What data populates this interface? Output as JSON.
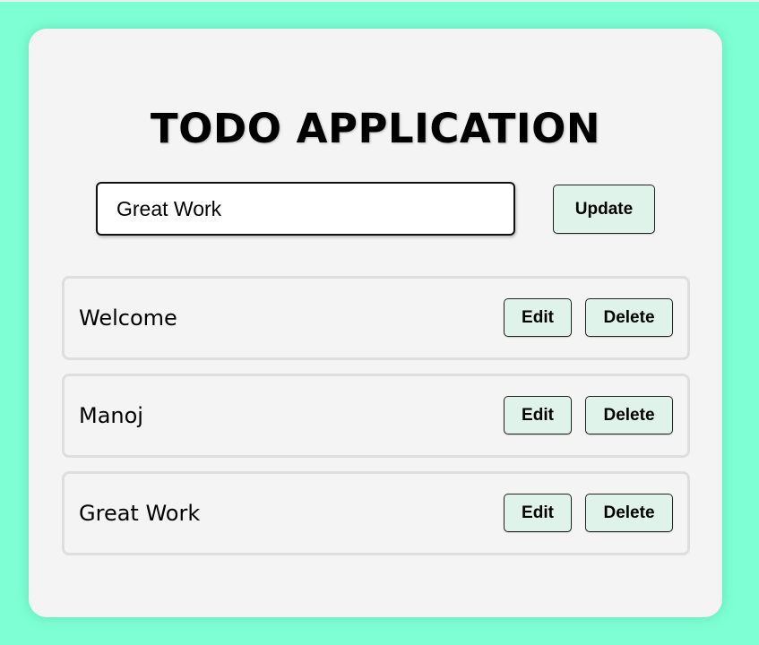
{
  "app": {
    "title": "TODO APPLICATION"
  },
  "form": {
    "input_value": "Great Work",
    "submit_label": "Update"
  },
  "todos": [
    {
      "text": "Welcome",
      "edit_label": "Edit",
      "delete_label": "Delete"
    },
    {
      "text": "Manoj",
      "edit_label": "Edit",
      "delete_label": "Delete"
    },
    {
      "text": "Great Work",
      "edit_label": "Edit",
      "delete_label": "Delete"
    }
  ],
  "colors": {
    "page_background": "#7fffd4",
    "card_background": "#f4f4f4",
    "button_background": "#dff3eb",
    "item_border": "#dedede"
  }
}
